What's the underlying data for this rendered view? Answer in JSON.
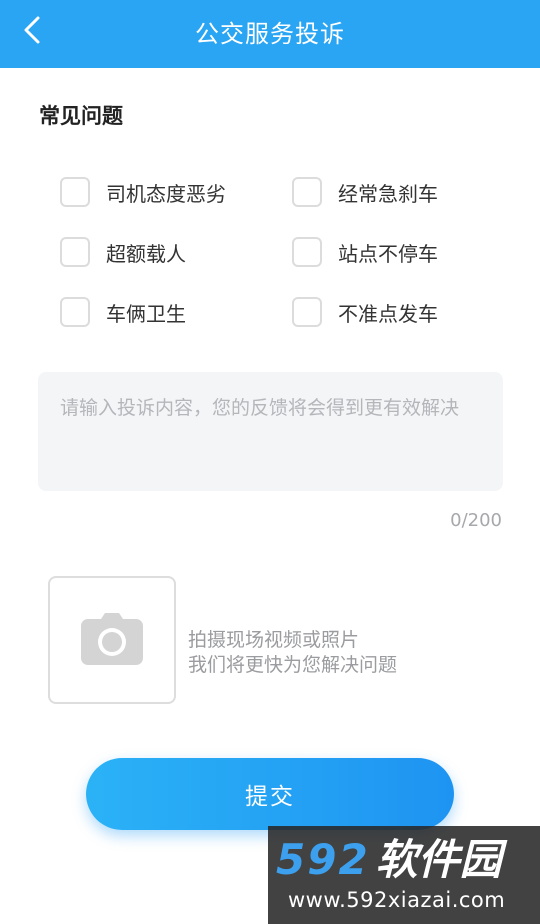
{
  "header": {
    "title": "公交服务投诉",
    "back_icon": "chevron-left-icon",
    "background_color": "#2aa5f3"
  },
  "common_issues": {
    "title": "常见问题",
    "options": [
      {
        "label": "司机态度恶劣",
        "checked": false
      },
      {
        "label": "经常急刹车",
        "checked": false
      },
      {
        "label": "超额载人",
        "checked": false
      },
      {
        "label": "站点不停车",
        "checked": false
      },
      {
        "label": "车俩卫生",
        "checked": false
      },
      {
        "label": "不准点发车",
        "checked": false
      }
    ]
  },
  "complaint": {
    "value": "",
    "placeholder": "请输入投诉内容，您的反馈将会得到更有效解决",
    "counter": "0/200"
  },
  "upload": {
    "icon": "camera-icon",
    "line1": "拍摄现场视频或照片",
    "line2": "我们将更快为您解决问题"
  },
  "submit": {
    "label": "提交",
    "color": "#1e94f2"
  },
  "watermark": {
    "digits": "592",
    "chinese": "软件园",
    "url": "www.592xiazai.com"
  }
}
